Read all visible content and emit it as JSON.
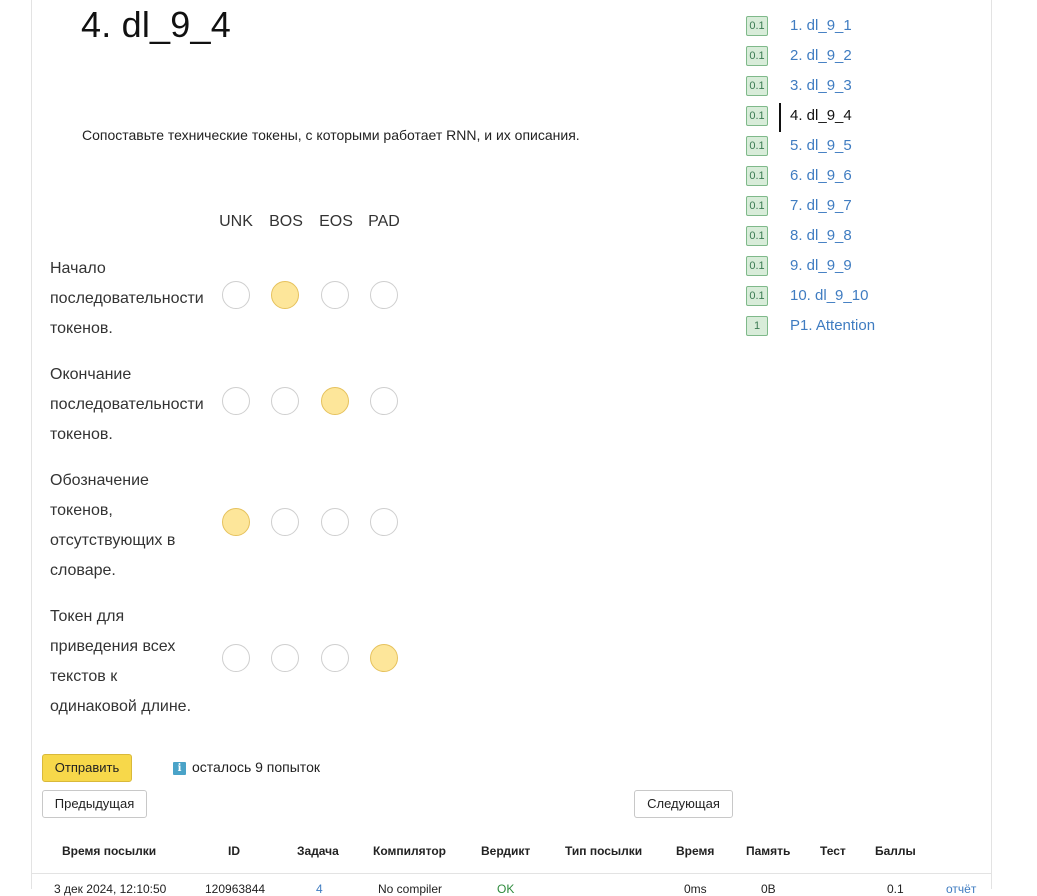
{
  "problem": {
    "title": "4. dl_9_4",
    "statement": "Сопоставьте технические токены, с которыми работает RNN, и их описания."
  },
  "matching": {
    "columns": [
      "UNK",
      "BOS",
      "EOS",
      "PAD"
    ],
    "rows": [
      {
        "lines": [
          "Начало",
          "последовательности",
          "токенов."
        ],
        "selected": "BOS"
      },
      {
        "lines": [
          "Окончание",
          "последовательности",
          "токенов."
        ],
        "selected": "EOS"
      },
      {
        "lines": [
          "Обозначение",
          "токенов,",
          "отсутствующих в",
          "словаре."
        ],
        "selected": "UNK"
      },
      {
        "lines": [
          "Токен для",
          "приведения всех",
          "текстов к",
          "одинаковой длине."
        ],
        "selected": "PAD"
      }
    ]
  },
  "problem_nav": [
    {
      "score": "0.1",
      "label": "1. dl_9_1"
    },
    {
      "score": "0.1",
      "label": "2. dl_9_2"
    },
    {
      "score": "0.1",
      "label": "3. dl_9_3"
    },
    {
      "score": "0.1",
      "label": "4. dl_9_4",
      "current": true
    },
    {
      "score": "0.1",
      "label": "5. dl_9_5"
    },
    {
      "score": "0.1",
      "label": "6. dl_9_6"
    },
    {
      "score": "0.1",
      "label": "7. dl_9_7"
    },
    {
      "score": "0.1",
      "label": "8. dl_9_8"
    },
    {
      "score": "0.1",
      "label": "9. dl_9_9"
    },
    {
      "score": "0.1",
      "label": "10. dl_9_10"
    },
    {
      "score": "1",
      "label": "P1. Attention"
    }
  ],
  "actions": {
    "submit_label": "Отправить",
    "attempts_text": "осталось 9 попыток",
    "info_icon": "i",
    "prev_label": "Предыдущая",
    "next_label": "Следующая"
  },
  "submissions": {
    "headers": [
      "Время посылки",
      "ID",
      "Задача",
      "Компилятор",
      "Вердикт",
      "Тип посылки",
      "Время",
      "Память",
      "Тест",
      "Баллы"
    ],
    "rows": [
      {
        "time": "3 дек 2024, 12:10:50",
        "id": "120963844",
        "task": "4",
        "compiler": "No compiler",
        "verdict": "OK",
        "type": "",
        "run_time": "0ms",
        "memory": "0B",
        "test": "",
        "score": "0.1",
        "link": "отчёт"
      }
    ]
  },
  "colors": {
    "selected_radio": "#fde69a",
    "link": "#3f7cc1",
    "submit_button": "#f7d84a",
    "score_badge": "#d8ecd9",
    "verdict_ok": "#2e8b3d"
  }
}
